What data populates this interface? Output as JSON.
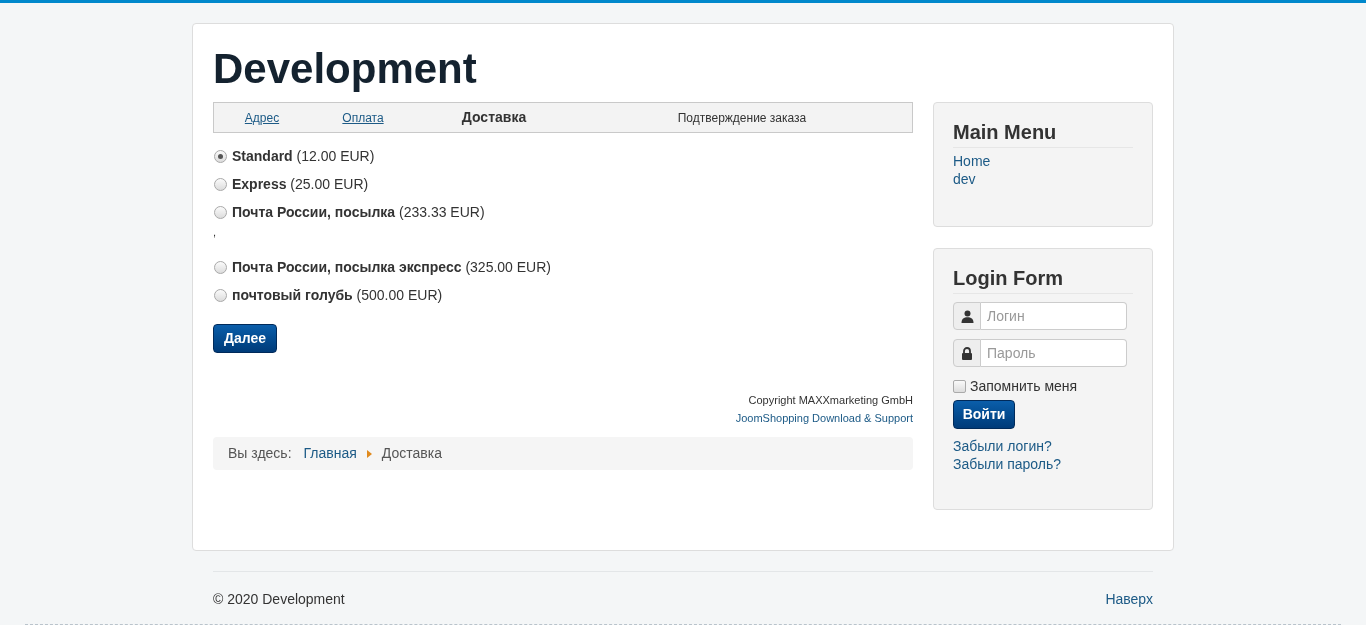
{
  "site_title": "Development",
  "checkout_steps": [
    {
      "label": "Адрес",
      "completed": true,
      "selected": false
    },
    {
      "label": "Оплата",
      "completed": true,
      "selected": false
    },
    {
      "label": "Доставка",
      "completed": false,
      "selected": true
    },
    {
      "label": "Подтверждение заказа",
      "completed": false,
      "selected": false
    }
  ],
  "shipping_options": [
    {
      "name": "Standard",
      "price": "(12.00 EUR)",
      "selected": true
    },
    {
      "name": "Express",
      "price": "(25.00 EUR)",
      "selected": false
    },
    {
      "name": "Почта России, посылка",
      "price": "(233.33 EUR)",
      "selected": false,
      "note": ","
    },
    {
      "name": "Почта России, посылка экспресс",
      "price": "(325.00 EUR)",
      "selected": false
    },
    {
      "name": "почтовый голубь",
      "price": "(500.00 EUR)",
      "selected": false
    }
  ],
  "next_button": "Далее",
  "copyright": "Copyright MAXXmarketing GmbH",
  "support_link": "JoomShopping Download & Support",
  "breadcrumb": {
    "label": "Вы здесь:",
    "items": [
      {
        "text": "Главная",
        "kind": "link"
      },
      {
        "text": "Доставка",
        "kind": "current"
      }
    ]
  },
  "sidebar": {
    "main_menu": {
      "title": "Main Menu",
      "items": [
        "Home",
        "dev"
      ]
    },
    "login_form": {
      "title": "Login Form",
      "username": {
        "placeholder": "Логин"
      },
      "password": {
        "placeholder": "Пароль"
      },
      "remember": {
        "label": "Запомнить меня",
        "checked": false
      },
      "submit": "Войти",
      "links": [
        "Забыли логин?",
        "Забыли пароль?"
      ]
    }
  },
  "footer": {
    "copyright": "© 2020 Development",
    "back_to_top": "Наверх"
  }
}
